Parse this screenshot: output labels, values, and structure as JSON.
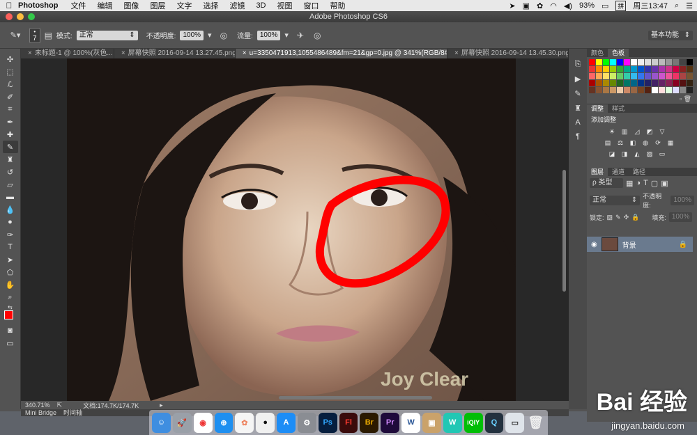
{
  "menubar": {
    "app": "Photoshop",
    "items": [
      "文件",
      "编辑",
      "图像",
      "图层",
      "文字",
      "选择",
      "滤镜",
      "3D",
      "视图",
      "窗口",
      "帮助"
    ],
    "battery": "93%",
    "ime": "拼",
    "clock": "周三13:47"
  },
  "window": {
    "title": "Adobe Photoshop CS6"
  },
  "options": {
    "brush_size": "7",
    "mode_label": "模式:",
    "mode_value": "正常",
    "opacity_label": "不透明度:",
    "opacity_value": "100%",
    "flow_label": "流量:",
    "flow_value": "100%",
    "workspace": "基本功能"
  },
  "tabs": [
    {
      "label": "未标题-1 @ 100%(灰色...",
      "active": false
    },
    {
      "label": "屏幕快照 2016-09-14 13.27.45.png",
      "active": false
    },
    {
      "label": "u=3350471913,1055486489&fm=21&gp=0.jpg @ 341%(RGB/8#) *",
      "active": true
    },
    {
      "label": "屏幕快照 2016-09-14 13.45.30.png",
      "active": false
    }
  ],
  "status": {
    "zoom": "340.71%",
    "doc": "文档:174.7K/174.7K"
  },
  "bottom_tabs": [
    "Mini Bridge",
    "时间轴"
  ],
  "panels": {
    "color_tabs": [
      "颜色",
      "色板"
    ],
    "adjust_tabs": [
      "调整",
      "样式"
    ],
    "add_adjustment": "添加调整",
    "layers_tabs": [
      "图层",
      "通道",
      "路径"
    ],
    "kind_label": "ρ 类型",
    "blend_mode": "正常",
    "opacity_label": "不透明度:",
    "opacity_value": "100%",
    "lock_label": "锁定:",
    "fill_label": "填充:",
    "fill_value": "100%",
    "layer_name": "背景"
  },
  "watermark": {
    "brand": "Bai 经验",
    "url": "jingyan.baidu.com"
  },
  "photo_watermark": "Joy Clear",
  "colors": {
    "foreground": "#ff0000",
    "background": "#ffffff",
    "annotation": "#ff0000"
  }
}
